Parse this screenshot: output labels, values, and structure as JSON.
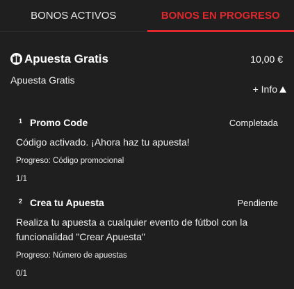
{
  "tabs": [
    {
      "label": "BONOS ACTIVOS",
      "active": false
    },
    {
      "label": "BONOS EN PROGRESO",
      "active": true
    }
  ],
  "accent_color": "#e0272b",
  "bonus": {
    "icon": "gift-icon",
    "title": "Apuesta Gratis",
    "amount": "10,00 €",
    "subtitle": "Apuesta Gratis",
    "info_label": "+ Info",
    "info_icon": "caret-up-icon"
  },
  "steps": [
    {
      "number": "1",
      "title": "Promo Code",
      "status": "Completada",
      "description": "Código activado. ¡Ahora haz tu apuesta!",
      "progress_label": "Progreso: Código promocional",
      "count": "1/1"
    },
    {
      "number": "2",
      "title": "Crea tu Apuesta",
      "status": "Pendiente",
      "description": "Realiza tu apuesta a cualquier evento de fútbol con la funcionalidad \"Crear Apuesta\"",
      "progress_label": "Progreso: Número de apuestas",
      "count": "0/1"
    }
  ]
}
